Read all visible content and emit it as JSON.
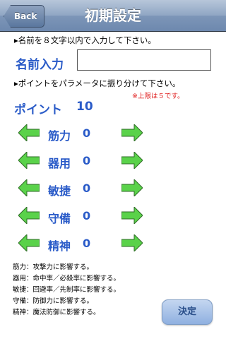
{
  "navbar": {
    "back_label": "Back",
    "title": "初期設定"
  },
  "name_section": {
    "instruction": "▸名前を８文字以内で入力して下さい。",
    "label": "名前入力",
    "input_value": ""
  },
  "points_section": {
    "instruction": "▸ポイントをパラメータに振り分けて下さい。",
    "limit_note": "※上限は５です。",
    "label": "ポイント",
    "value": "10"
  },
  "stats": [
    {
      "label": "筋力",
      "value": "0"
    },
    {
      "label": "器用",
      "value": "0"
    },
    {
      "label": "敏捷",
      "value": "0"
    },
    {
      "label": "守備",
      "value": "0"
    },
    {
      "label": "精神",
      "value": "0"
    }
  ],
  "descriptions": [
    "筋力：攻撃力に影響する。",
    "器用：命中率／必殺率に影響する。",
    "敏捷：回避率／先制率に影響する。",
    "守備：防御力に影響する。",
    "精神：魔法防御に影響する。"
  ],
  "decide_label": "決定",
  "colors": {
    "accent": "#2a5bc8",
    "arrow": "#5ad24a",
    "limit": "#e02020",
    "navbar": "#7d96b8"
  }
}
